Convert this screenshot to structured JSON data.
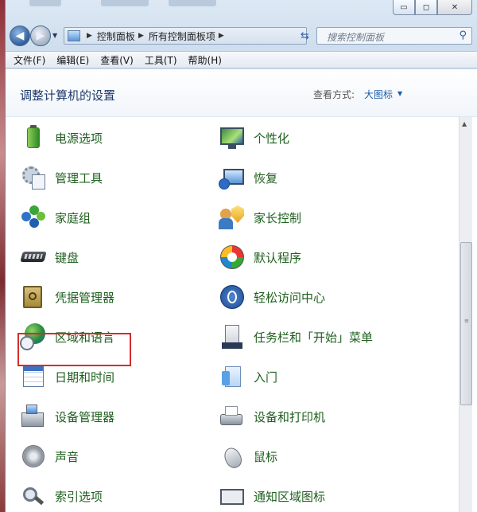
{
  "window": {
    "buttons": {
      "minimize": "▭",
      "maximize": "◻",
      "close": "✕"
    }
  },
  "nav": {
    "breadcrumbs": [
      "控制面板",
      "所有控制面板项"
    ],
    "search_placeholder": "搜索控制面板"
  },
  "menubar": {
    "items": [
      "文件(F)",
      "编辑(E)",
      "查看(V)",
      "工具(T)",
      "帮助(H)"
    ]
  },
  "header": {
    "title": "调整计算机的设置",
    "view_by_label": "查看方式:",
    "view_by_value": "大图标"
  },
  "items": [
    {
      "label": "电源选项",
      "icon": "battery-icon"
    },
    {
      "label": "个性化",
      "icon": "personalization-icon"
    },
    {
      "label": "管理工具",
      "icon": "admin-tools-icon"
    },
    {
      "label": "恢复",
      "icon": "recovery-icon"
    },
    {
      "label": "家庭组",
      "icon": "homegroup-icon"
    },
    {
      "label": "家长控制",
      "icon": "parental-controls-icon"
    },
    {
      "label": "键盘",
      "icon": "keyboard-icon"
    },
    {
      "label": "默认程序",
      "icon": "default-programs-icon"
    },
    {
      "label": "凭据管理器",
      "icon": "credential-manager-icon"
    },
    {
      "label": "轻松访问中心",
      "icon": "ease-of-access-icon"
    },
    {
      "label": "区域和语言",
      "icon": "region-language-icon"
    },
    {
      "label": "任务栏和「开始」菜单",
      "icon": "taskbar-icon"
    },
    {
      "label": "日期和时间",
      "icon": "calendar-icon"
    },
    {
      "label": "入门",
      "icon": "getting-started-icon"
    },
    {
      "label": "设备管理器",
      "icon": "device-manager-icon"
    },
    {
      "label": "设备和打印机",
      "icon": "printer-icon"
    },
    {
      "label": "声音",
      "icon": "speaker-icon"
    },
    {
      "label": "鼠标",
      "icon": "mouse-icon"
    },
    {
      "label": "索引选项",
      "icon": "indexing-icon"
    },
    {
      "label": "通知区域图标",
      "icon": "notification-icon"
    }
  ],
  "highlighted_item": "区域和语言",
  "colors": {
    "item_text": "#1e5f1e",
    "highlight_border": "#d42c2c",
    "title": "#1b3a6b"
  }
}
